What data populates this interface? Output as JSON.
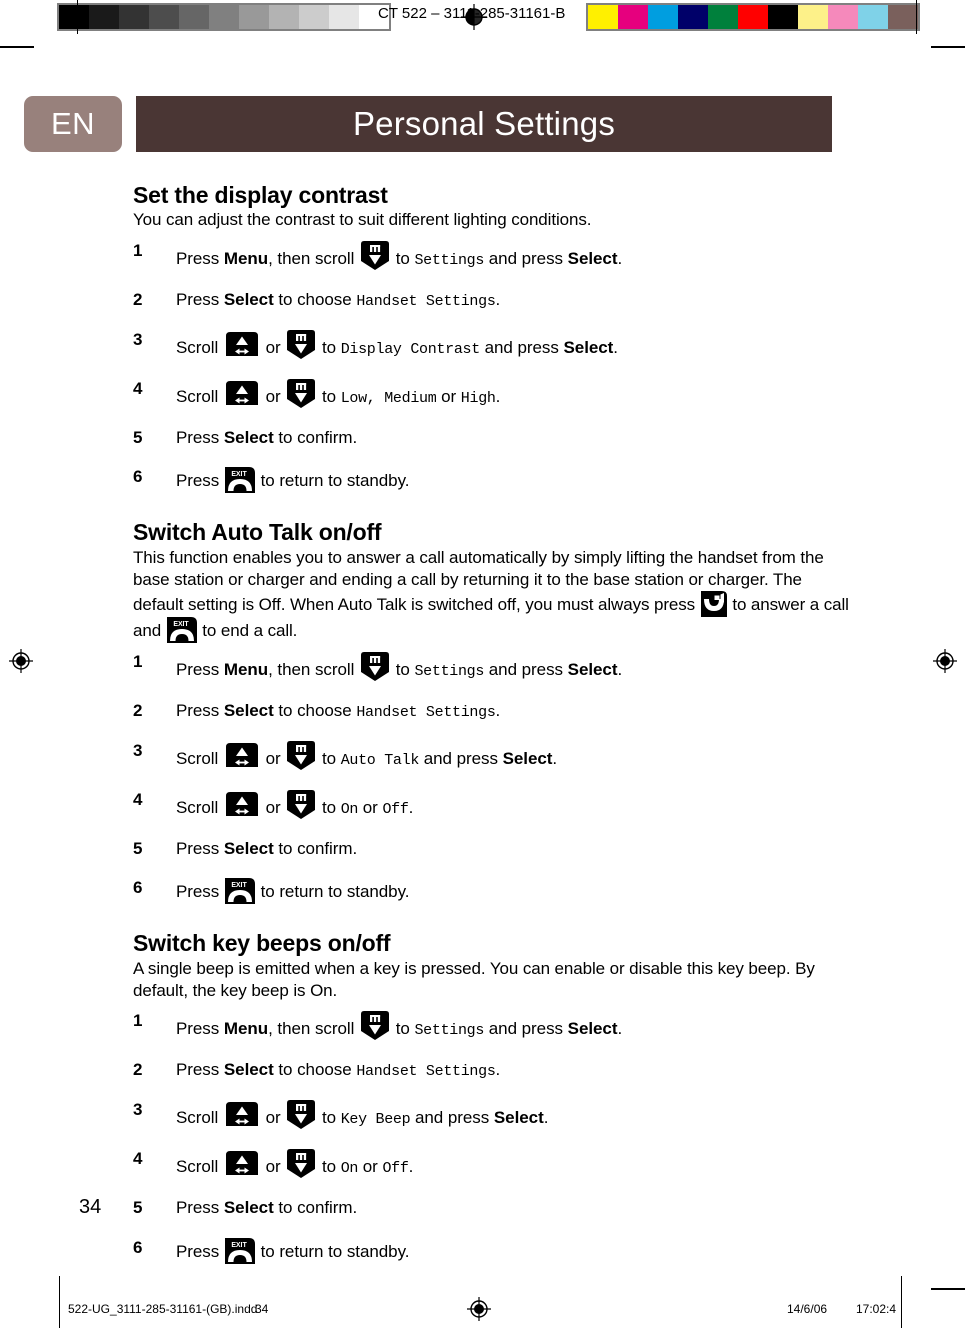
{
  "calibration": {
    "code": "CT 522  –    3111-285-31161-B",
    "gray_ramp": [
      "#000000",
      "#1a1a1a",
      "#333333",
      "#4d4d4d",
      "#666666",
      "#808080",
      "#999999",
      "#b3b3b3",
      "#cccccc",
      "#e6e6e6",
      "#ffffff"
    ],
    "color_ramp": [
      "#fff000",
      "#e6007e",
      "#009ee0",
      "#000069",
      "#00803c",
      "#ff0000",
      "#000000",
      "#fdf189",
      "#f589bb",
      "#7fd2e8",
      "#7a605c"
    ]
  },
  "header": {
    "language": "EN",
    "title": "Personal Settings",
    "title_bg": "#4a3634",
    "tab_bg": "#98817c"
  },
  "sections": [
    {
      "title": "Set the display contrast",
      "intro": "You can adjust the contrast to suit different lighting conditions.",
      "steps": [
        {
          "num": "1",
          "parts": [
            {
              "t": "text",
              "v": "Press "
            },
            {
              "t": "key",
              "v": "Menu"
            },
            {
              "t": "text",
              "v": ", then scroll "
            },
            {
              "t": "icon",
              "v": "scroll-down-key-icon"
            },
            {
              "t": "text",
              "v": " to "
            },
            {
              "t": "menu",
              "v": "Settings"
            },
            {
              "t": "text",
              "v": "  and press "
            },
            {
              "t": "key",
              "v": "Select"
            },
            {
              "t": "text",
              "v": "."
            }
          ]
        },
        {
          "num": "2",
          "parts": [
            {
              "t": "text",
              "v": "Press "
            },
            {
              "t": "key",
              "v": "Select"
            },
            {
              "t": "text",
              "v": " to choose "
            },
            {
              "t": "menu",
              "v": "Handset Settings"
            },
            {
              "t": "text",
              "v": "."
            }
          ]
        },
        {
          "num": "3",
          "parts": [
            {
              "t": "text",
              "v": "Scroll "
            },
            {
              "t": "icon",
              "v": "scroll-up-key-icon"
            },
            {
              "t": "text",
              "v": " or "
            },
            {
              "t": "icon",
              "v": "scroll-down-key-icon"
            },
            {
              "t": "text",
              "v": " to "
            },
            {
              "t": "menu",
              "v": "Display Contrast"
            },
            {
              "t": "text",
              "v": "  and press "
            },
            {
              "t": "key",
              "v": "Select"
            },
            {
              "t": "text",
              "v": "."
            }
          ]
        },
        {
          "num": "4",
          "parts": [
            {
              "t": "text",
              "v": "Scroll "
            },
            {
              "t": "icon",
              "v": "scroll-up-key-icon"
            },
            {
              "t": "text",
              "v": " or "
            },
            {
              "t": "icon",
              "v": "scroll-down-key-icon"
            },
            {
              "t": "text",
              "v": " to "
            },
            {
              "t": "menu",
              "v": "Low, Medium"
            },
            {
              "t": "text",
              "v": "  or "
            },
            {
              "t": "menu",
              "v": "High"
            },
            {
              "t": "text",
              "v": "."
            }
          ]
        },
        {
          "num": "5",
          "parts": [
            {
              "t": "text",
              "v": "Press "
            },
            {
              "t": "key",
              "v": "Select"
            },
            {
              "t": "text",
              "v": " to confirm."
            }
          ]
        },
        {
          "num": "6",
          "parts": [
            {
              "t": "text",
              "v": "Press "
            },
            {
              "t": "icon",
              "v": "exit-hangup-key-icon"
            },
            {
              "t": "text",
              "v": " to return to standby."
            }
          ]
        }
      ]
    },
    {
      "title": "Switch Auto Talk on/off",
      "intro_parts": [
        {
          "t": "text",
          "v": "This function enables you to answer a call automatically by simply lifting the handset from the base station or charger and ending a call by returning it to the base station or charger. The default setting is Off. When Auto Talk is switched off, you must always press "
        },
        {
          "t": "icon",
          "v": "talk-answer-key-icon"
        },
        {
          "t": "text",
          "v": " to answer a call and "
        },
        {
          "t": "icon",
          "v": "exit-hangup-key-icon"
        },
        {
          "t": "text",
          "v": " to end a call."
        }
      ],
      "steps": [
        {
          "num": "1",
          "parts": [
            {
              "t": "text",
              "v": "Press "
            },
            {
              "t": "key",
              "v": "Menu"
            },
            {
              "t": "text",
              "v": ", then scroll "
            },
            {
              "t": "icon",
              "v": "scroll-down-key-icon"
            },
            {
              "t": "text",
              "v": " to "
            },
            {
              "t": "menu",
              "v": "Settings"
            },
            {
              "t": "text",
              "v": "  and press "
            },
            {
              "t": "key",
              "v": "Select"
            },
            {
              "t": "text",
              "v": "."
            }
          ]
        },
        {
          "num": "2",
          "parts": [
            {
              "t": "text",
              "v": "Press "
            },
            {
              "t": "key",
              "v": "Select"
            },
            {
              "t": "text",
              "v": " to choose "
            },
            {
              "t": "menu",
              "v": "Handset Settings"
            },
            {
              "t": "text",
              "v": "."
            }
          ]
        },
        {
          "num": "3",
          "parts": [
            {
              "t": "text",
              "v": "Scroll "
            },
            {
              "t": "icon",
              "v": "scroll-up-key-icon"
            },
            {
              "t": "text",
              "v": " or "
            },
            {
              "t": "icon",
              "v": "scroll-down-key-icon"
            },
            {
              "t": "text",
              "v": " to "
            },
            {
              "t": "menu",
              "v": "Auto Talk"
            },
            {
              "t": "text",
              "v": "  and press "
            },
            {
              "t": "key",
              "v": "Select"
            },
            {
              "t": "text",
              "v": "."
            }
          ]
        },
        {
          "num": "4",
          "parts": [
            {
              "t": "text",
              "v": "Scroll "
            },
            {
              "t": "icon",
              "v": "scroll-up-key-icon"
            },
            {
              "t": "text",
              "v": " or "
            },
            {
              "t": "icon",
              "v": "scroll-down-key-icon"
            },
            {
              "t": "text",
              "v": " to "
            },
            {
              "t": "menu",
              "v": "On"
            },
            {
              "t": "text",
              "v": "  or "
            },
            {
              "t": "menu",
              "v": "Off"
            },
            {
              "t": "text",
              "v": "."
            }
          ]
        },
        {
          "num": "5",
          "parts": [
            {
              "t": "text",
              "v": "Press "
            },
            {
              "t": "key",
              "v": "Select"
            },
            {
              "t": "text",
              "v": " to confirm."
            }
          ]
        },
        {
          "num": "6",
          "parts": [
            {
              "t": "text",
              "v": "Press "
            },
            {
              "t": "icon",
              "v": "exit-hangup-key-icon"
            },
            {
              "t": "text",
              "v": " to return to standby."
            }
          ]
        }
      ]
    },
    {
      "title": "Switch key beeps on/off",
      "intro": "A single beep is emitted when a key is pressed. You can enable or disable this key beep. By default, the key beep is On.",
      "steps": [
        {
          "num": "1",
          "parts": [
            {
              "t": "text",
              "v": "Press "
            },
            {
              "t": "key",
              "v": "Menu"
            },
            {
              "t": "text",
              "v": ", then scroll "
            },
            {
              "t": "icon",
              "v": "scroll-down-key-icon"
            },
            {
              "t": "text",
              "v": " to "
            },
            {
              "t": "menu",
              "v": "Settings"
            },
            {
              "t": "text",
              "v": "  and press "
            },
            {
              "t": "key",
              "v": "Select"
            },
            {
              "t": "text",
              "v": "."
            }
          ]
        },
        {
          "num": "2",
          "parts": [
            {
              "t": "text",
              "v": "Press "
            },
            {
              "t": "key",
              "v": "Select"
            },
            {
              "t": "text",
              "v": " to choose "
            },
            {
              "t": "menu",
              "v": "Handset Settings"
            },
            {
              "t": "text",
              "v": "."
            }
          ]
        },
        {
          "num": "3",
          "parts": [
            {
              "t": "text",
              "v": "Scroll "
            },
            {
              "t": "icon",
              "v": "scroll-up-key-icon"
            },
            {
              "t": "text",
              "v": " or "
            },
            {
              "t": "icon",
              "v": "scroll-down-key-icon"
            },
            {
              "t": "text",
              "v": " to "
            },
            {
              "t": "menu",
              "v": "Key Beep"
            },
            {
              "t": "text",
              "v": "  and press "
            },
            {
              "t": "key",
              "v": "Select"
            },
            {
              "t": "text",
              "v": "."
            }
          ]
        },
        {
          "num": "4",
          "parts": [
            {
              "t": "text",
              "v": "Scroll "
            },
            {
              "t": "icon",
              "v": "scroll-up-key-icon"
            },
            {
              "t": "text",
              "v": " or "
            },
            {
              "t": "icon",
              "v": "scroll-down-key-icon"
            },
            {
              "t": "text",
              "v": " to "
            },
            {
              "t": "menu",
              "v": "On"
            },
            {
              "t": "text",
              "v": "  or "
            },
            {
              "t": "menu",
              "v": "Off"
            },
            {
              "t": "text",
              "v": "."
            }
          ]
        },
        {
          "num": "5",
          "parts": [
            {
              "t": "text",
              "v": "Press "
            },
            {
              "t": "key",
              "v": "Select"
            },
            {
              "t": "text",
              "v": " to confirm."
            }
          ]
        },
        {
          "num": "6",
          "parts": [
            {
              "t": "text",
              "v": "Press "
            },
            {
              "t": "icon",
              "v": "exit-hangup-key-icon"
            },
            {
              "t": "text",
              "v": " to return to standby."
            }
          ]
        }
      ]
    }
  ],
  "page_number": "34",
  "footer": {
    "filename": "522-UG_3111-285-31161-(GB).indd",
    "page": "34",
    "date": "14/6/06",
    "time": "17:02:4"
  }
}
